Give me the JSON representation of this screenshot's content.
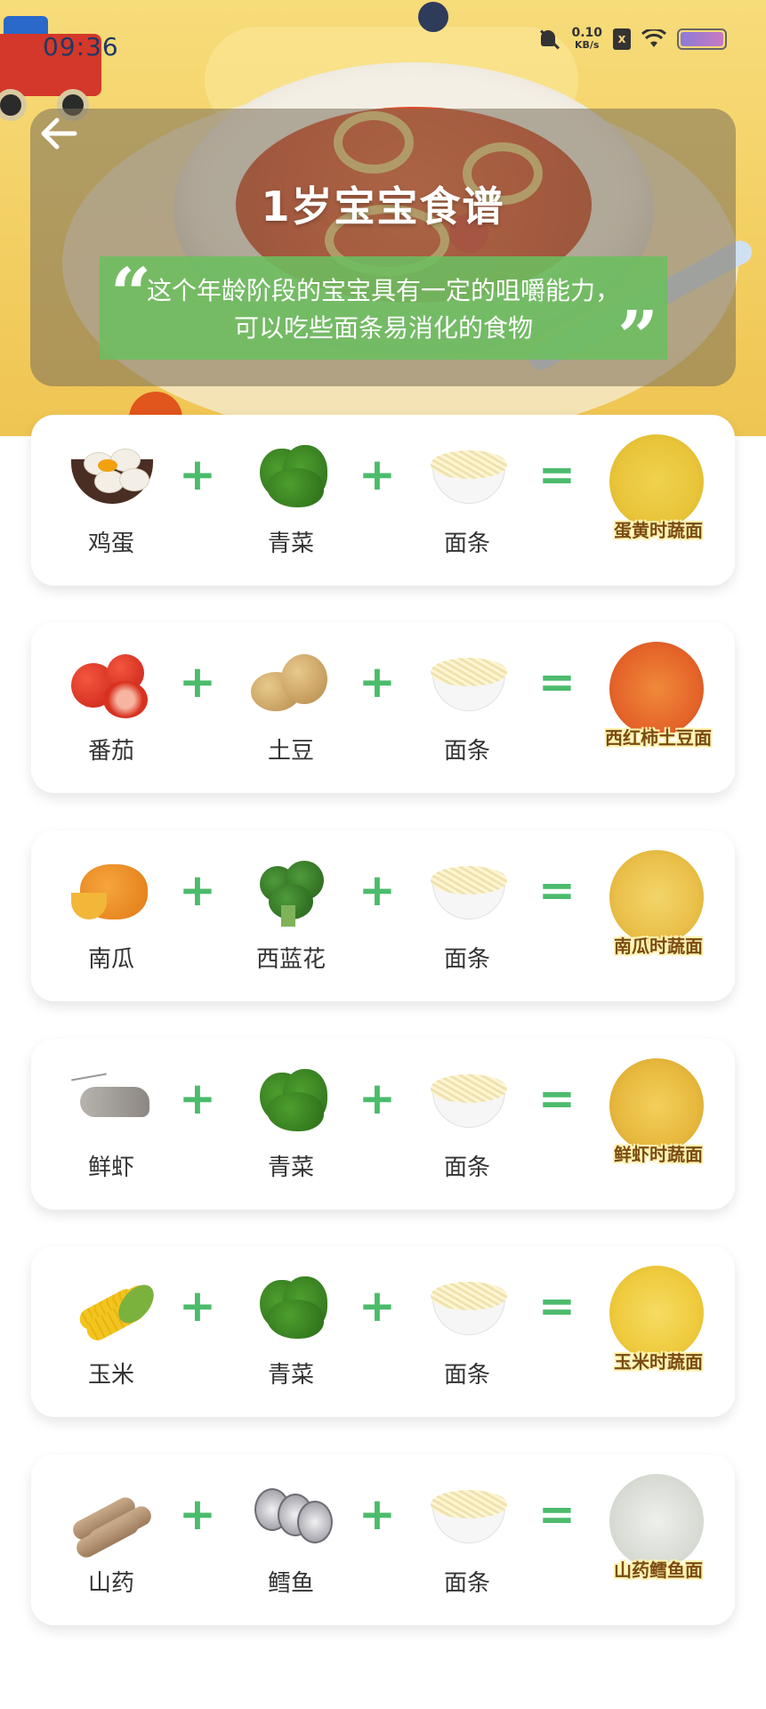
{
  "status_bar": {
    "time": "09:36",
    "net_speed_value": "0.10",
    "net_speed_unit": "KB/s",
    "sim_label": "x",
    "icons": [
      "mute-icon",
      "sim-icon",
      "wifi-icon",
      "battery-icon"
    ]
  },
  "header": {
    "title": "1岁宝宝食谱",
    "description": "这个年龄阶段的宝宝具有一定的咀嚼能力，可以吃些面条易消化的食物",
    "quote_open": "“",
    "quote_close": "”"
  },
  "operators": {
    "plus": "+",
    "equals": "="
  },
  "recipes": [
    {
      "ingredients": [
        {
          "name": "鸡蛋",
          "icon": "egg"
        },
        {
          "name": "青菜",
          "icon": "greens"
        },
        {
          "name": "面条",
          "icon": "noodles"
        }
      ],
      "result": "蛋黄时蔬面"
    },
    {
      "ingredients": [
        {
          "name": "番茄",
          "icon": "tomato"
        },
        {
          "name": "土豆",
          "icon": "potato"
        },
        {
          "name": "面条",
          "icon": "noodles"
        }
      ],
      "result": "西红柿土豆面"
    },
    {
      "ingredients": [
        {
          "name": "南瓜",
          "icon": "pumpkin"
        },
        {
          "name": "西蓝花",
          "icon": "broccoli"
        },
        {
          "name": "面条",
          "icon": "noodles"
        }
      ],
      "result": "南瓜时蔬面"
    },
    {
      "ingredients": [
        {
          "name": "鲜虾",
          "icon": "shrimp"
        },
        {
          "name": "青菜",
          "icon": "greens"
        },
        {
          "name": "面条",
          "icon": "noodles"
        }
      ],
      "result": "鲜虾时蔬面"
    },
    {
      "ingredients": [
        {
          "name": "玉米",
          "icon": "corn"
        },
        {
          "name": "青菜",
          "icon": "greens"
        },
        {
          "name": "面条",
          "icon": "noodles"
        }
      ],
      "result": "玉米时蔬面"
    },
    {
      "ingredients": [
        {
          "name": "山药",
          "icon": "yam"
        },
        {
          "name": "鳕鱼",
          "icon": "cod"
        },
        {
          "name": "面条",
          "icon": "noodles"
        }
      ],
      "result": "山药鳕鱼面"
    }
  ],
  "colors": {
    "accent_green": "#4cbb6c",
    "quote_green": "#6cbe60",
    "hero_yellow": "#f3cf63"
  }
}
